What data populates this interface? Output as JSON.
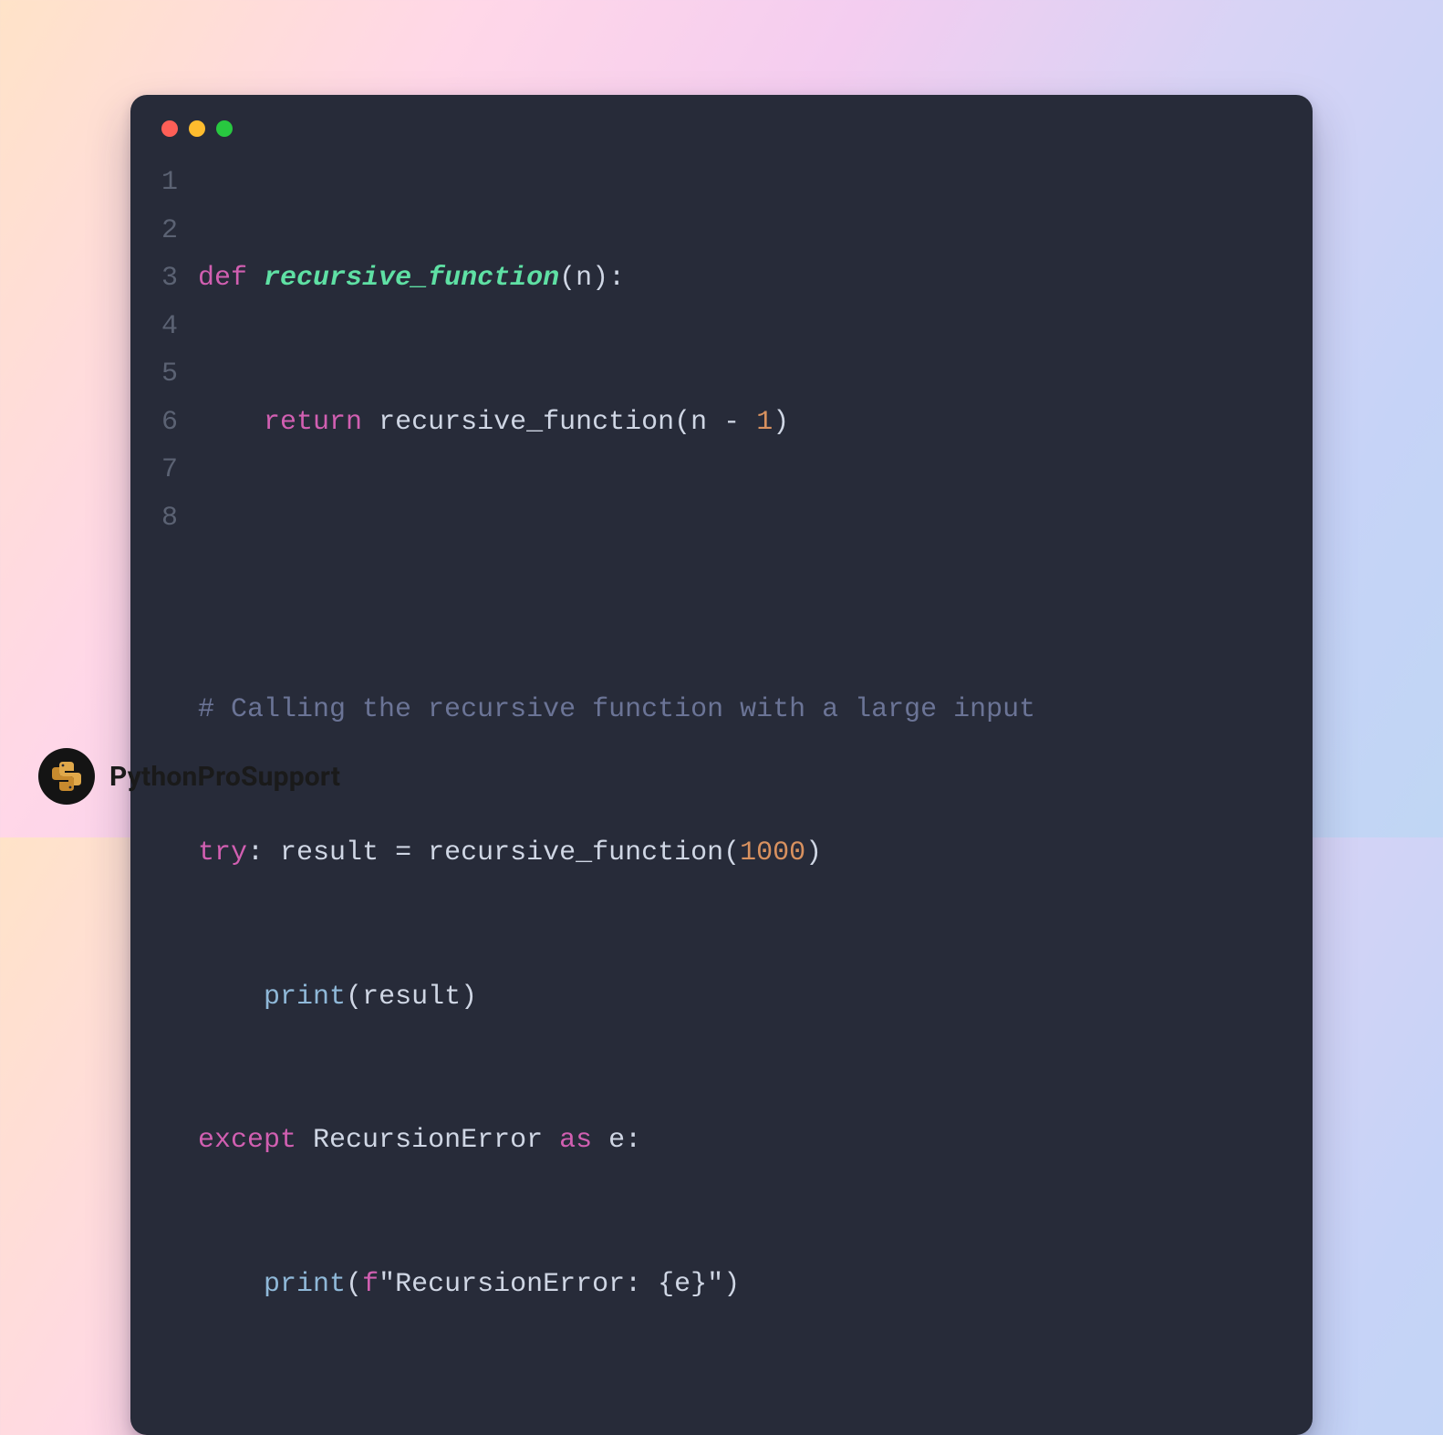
{
  "brand": {
    "name": "PythonProSupport"
  },
  "editor": {
    "line_numbers": [
      "1",
      "2",
      "3",
      "4",
      "5",
      "6",
      "7",
      "8"
    ],
    "code": {
      "l1": {
        "kw": "def",
        "fn": "recursive_function",
        "params": "n",
        "close": "):"
      },
      "l2": {
        "kw": "return",
        "call": "recursive_function",
        "open": "(",
        "arg_n": "n",
        "minus": " - ",
        "one": "1",
        "close": ")"
      },
      "l3": {
        "blank": ""
      },
      "l4": {
        "comment": "# Calling the recursive function with a large input"
      },
      "l5": {
        "kw": "try",
        "colon": ":",
        "assign": " result = ",
        "call": "recursive_function",
        "open": "(",
        "num": "1000",
        "close": ")"
      },
      "l6": {
        "indent": "    ",
        "call": "print",
        "open": "(",
        "arg": "result",
        "close": ")"
      },
      "l7": {
        "kw1": "except",
        "cls": " RecursionError ",
        "kw2": "as",
        "var": " e",
        "colon": ":"
      },
      "l8": {
        "indent": "    ",
        "call": "print",
        "open": "(",
        "fprefix": "f",
        "q1": "\"",
        "str": "RecursionError: ",
        "brace_open": "{",
        "expr": "e",
        "brace_close": "}",
        "q2": "\"",
        "close": ")"
      }
    }
  }
}
